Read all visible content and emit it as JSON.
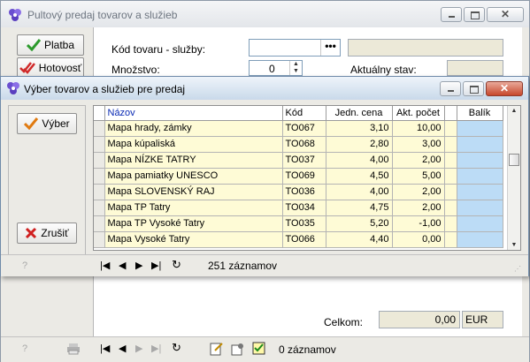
{
  "main": {
    "title": "Pultový predaj tovarov a služieb",
    "buttons": {
      "platba": "Platba",
      "hotovost": "Hotovosť"
    },
    "form": {
      "kod_label": "Kód tovaru  - služby:",
      "kod_value": "",
      "dots": "•••",
      "mnozstvo_label": "Množstvo:",
      "mnozstvo_value": "0",
      "aktualny_label": "Aktuálny stav:"
    },
    "totals": {
      "celkom_label": "Celkom:",
      "celkom_value": "0,00",
      "currency": "EUR"
    },
    "status": {
      "records": "0 záznamov"
    }
  },
  "dialog": {
    "title": "Výber tovarov a služieb pre predaj",
    "buttons": {
      "vyber": "Výber",
      "zrusit": "Zrušiť"
    },
    "columns": [
      "Názov",
      "Kód",
      "Jedn. cena",
      "Akt. počet",
      "",
      "Balík"
    ],
    "rows": [
      {
        "nazov": "Mapa hrady, zámky",
        "kod": "TO067",
        "cena": "3,10",
        "pocet": "10,00"
      },
      {
        "nazov": "Mapa kúpaliská",
        "kod": "TO068",
        "cena": "2,80",
        "pocet": "3,00"
      },
      {
        "nazov": "Mapa NÍZKE TATRY",
        "kod": "TO037",
        "cena": "4,00",
        "pocet": "2,00"
      },
      {
        "nazov": "Mapa pamiatky UNESCO",
        "kod": "TO069",
        "cena": "4,50",
        "pocet": "5,00"
      },
      {
        "nazov": "Mapa SLOVENSKÝ RAJ",
        "kod": "TO036",
        "cena": "4,00",
        "pocet": "2,00"
      },
      {
        "nazov": "Mapa TP Tatry",
        "kod": "TO034",
        "cena": "4,75",
        "pocet": "2,00"
      },
      {
        "nazov": "Mapa TP Vysoké Tatry",
        "kod": "TO035",
        "cena": "5,20",
        "pocet": "-1,00"
      },
      {
        "nazov": "Mapa Vysoké Tatry",
        "kod": "TO066",
        "cena": "4,40",
        "pocet": "0,00"
      }
    ],
    "status": {
      "records": "251 záznamov"
    }
  },
  "colors": {
    "grid_row": "#fefbd6",
    "balik": "#bcdcf6",
    "header_text": "#0a2ab4"
  }
}
